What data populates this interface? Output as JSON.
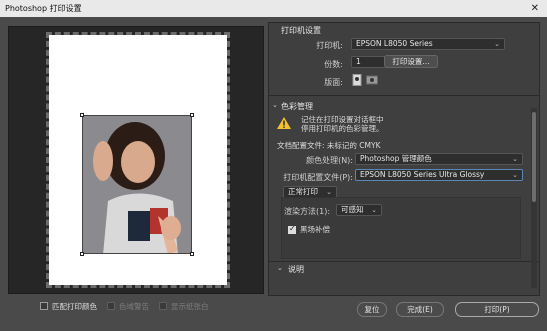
{
  "window": {
    "title": "Photoshop 打印设置",
    "close_glyph": "✕"
  },
  "preview": {
    "header_text": ""
  },
  "bottom_left": {
    "match_print_colors": "匹配打印颜色",
    "gamut_warning": "色域警告",
    "show_paper_white": "显示纸张白"
  },
  "printer_settings": {
    "section_title": "打印机设置",
    "printer_label": "打印机:",
    "printer_value": "EPSON L8050 Series",
    "copies_label": "份数:",
    "copies_value": "1",
    "print_settings_button": "打印设置...",
    "layout_label": "版面:"
  },
  "color_management": {
    "section_title": "色彩管理",
    "warning_line1": "记住在打印设置对话框中",
    "warning_line2": "停用打印机的色彩管理。",
    "document_profile": "文档配置文件: 未标记的 CMYK",
    "color_handling_label": "颜色处理(N):",
    "color_handling_value": "Photoshop 管理颜色",
    "printer_profile_label": "打印机配置文件(P):",
    "printer_profile_value": "EPSON L8050 Series Ultra Glossy",
    "normal_print": "正常打印",
    "rendering_intent_label": "渲染方法(1):",
    "rendering_intent_value": "可感知",
    "black_point_compensation": "黑场补偿"
  },
  "description": {
    "section_title": "说明"
  },
  "buttons": {
    "reset": "复位",
    "done": "完成(E)",
    "print": "打印(P)"
  },
  "colors": {
    "accent": "#5b86b5",
    "panel": "#3f3f3f",
    "background": "#4a4a4a"
  }
}
